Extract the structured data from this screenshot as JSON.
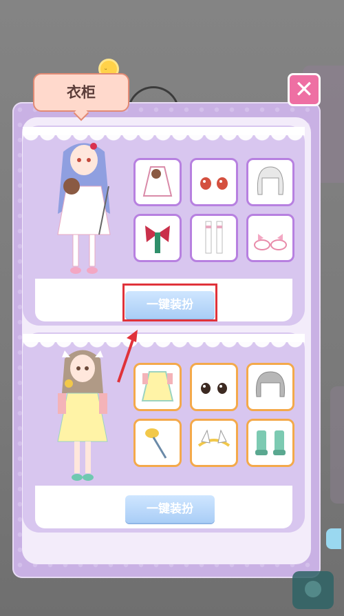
{
  "window": {
    "title": "衣柜"
  },
  "close_button": {
    "label": "✕"
  },
  "outfits": [
    {
      "name": "lolita-white",
      "items": [
        "dress-icon",
        "eyes-icon",
        "hair-icon",
        "bow-icon",
        "stockings-icon",
        "shoes-icon"
      ],
      "button_label": "一键装扮",
      "highlighted": true
    },
    {
      "name": "cow-yellow",
      "items": [
        "dress-icon",
        "eyes-icon",
        "hair-icon",
        "wand-icon",
        "headband-icon",
        "boots-icon"
      ],
      "button_label": "一键装扮",
      "highlighted": false
    }
  ],
  "colors": {
    "panel": "#c9b1e4",
    "button": "#a9cdf6",
    "highlight": "#e0323a",
    "close": "#ee6fa3",
    "tile_border_outfit1": "#b780e0",
    "tile_border_outfit2": "#f4a94a"
  }
}
